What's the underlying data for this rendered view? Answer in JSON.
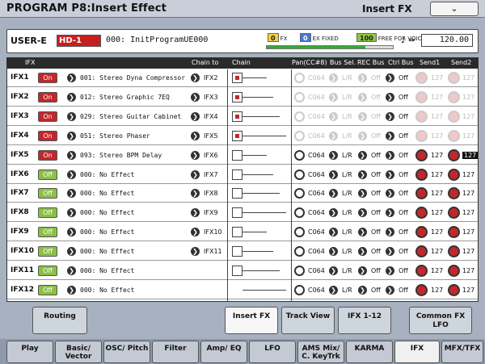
{
  "title": "PROGRAM P8:Insert Effect",
  "page_name": "Insert FX",
  "page_menu": "❯",
  "program": {
    "bank": "USER-E",
    "id": "HD-1",
    "name": "000: InitProgramUE000"
  },
  "status": {
    "fx_count": "0",
    "fx_label": "FX",
    "fixed_count": "0",
    "fixed_label": "EX FIXED",
    "free_count": "100",
    "free_label": "FREE FOR VOICES",
    "meter_fraction": 0.78
  },
  "tempo": {
    "symbol": "♩ =",
    "value": "120.00"
  },
  "columns": [
    "IFX",
    "Chain to",
    "Chain",
    "Pan(CC#8)",
    "Bus Sel.",
    "REC Bus",
    "Ctrl Bus",
    "Send1",
    "Send2"
  ],
  "rows": [
    {
      "num": "IFX1",
      "state": "On",
      "fx": "001: Stereo Dyna Compressor",
      "chain_to": "IFX2",
      "active": true,
      "pan": "C064",
      "bus": "L/R",
      "rec": "Off",
      "ctrl": "Off",
      "send1": "127",
      "send2": "127",
      "dim": true
    },
    {
      "num": "IFX2",
      "state": "On",
      "fx": "012: Stereo Graphic 7EQ",
      "chain_to": "IFX3",
      "active": true,
      "pan": "C064",
      "bus": "L/R",
      "rec": "Off",
      "ctrl": "Off",
      "send1": "127",
      "send2": "127",
      "dim": true
    },
    {
      "num": "IFX3",
      "state": "On",
      "fx": "029: Stereo Guitar Cabinet",
      "chain_to": "IFX4",
      "active": true,
      "pan": "C064",
      "bus": "L/R",
      "rec": "Off",
      "ctrl": "Off",
      "send1": "127",
      "send2": "127",
      "dim": true
    },
    {
      "num": "IFX4",
      "state": "On",
      "fx": "051: Stereo Phaser",
      "chain_to": "IFX5",
      "active": true,
      "pan": "C064",
      "bus": "L/R",
      "rec": "Off",
      "ctrl": "Off",
      "send1": "127",
      "send2": "127",
      "dim": true
    },
    {
      "num": "IFX5",
      "state": "On",
      "fx": "093: Stereo BPM Delay",
      "chain_to": "IFX6",
      "active": false,
      "pan": "C064",
      "bus": "L/R",
      "rec": "Off",
      "ctrl": "Off",
      "send1": "127",
      "send2": "127",
      "dim": false,
      "send2_hl": true
    },
    {
      "num": "IFX6",
      "state": "Off",
      "fx": "000: No Effect",
      "chain_to": "IFX7",
      "active": false,
      "pan": "C064",
      "bus": "L/R",
      "rec": "Off",
      "ctrl": "Off",
      "send1": "127",
      "send2": "127",
      "dim": false
    },
    {
      "num": "IFX7",
      "state": "Off",
      "fx": "000: No Effect",
      "chain_to": "IFX8",
      "active": false,
      "pan": "C064",
      "bus": "L/R",
      "rec": "Off",
      "ctrl": "Off",
      "send1": "127",
      "send2": "127",
      "dim": false
    },
    {
      "num": "IFX8",
      "state": "Off",
      "fx": "000: No Effect",
      "chain_to": "IFX9",
      "active": false,
      "pan": "C064",
      "bus": "L/R",
      "rec": "Off",
      "ctrl": "Off",
      "send1": "127",
      "send2": "127",
      "dim": false
    },
    {
      "num": "IFX9",
      "state": "Off",
      "fx": "000: No Effect",
      "chain_to": "IFX10",
      "active": false,
      "pan": "C064",
      "bus": "L/R",
      "rec": "Off",
      "ctrl": "Off",
      "send1": "127",
      "send2": "127",
      "dim": false
    },
    {
      "num": "IFX10",
      "state": "Off",
      "fx": "000: No Effect",
      "chain_to": "IFX11",
      "active": false,
      "pan": "C064",
      "bus": "L/R",
      "rec": "Off",
      "ctrl": "Off",
      "send1": "127",
      "send2": "127",
      "dim": false
    },
    {
      "num": "IFX11",
      "state": "Off",
      "fx": "000: No Effect",
      "chain_to": "",
      "active": false,
      "pan": "C064",
      "bus": "L/R",
      "rec": "Off",
      "ctrl": "Off",
      "send1": "127",
      "send2": "127",
      "dim": false
    },
    {
      "num": "IFX12",
      "state": "Off",
      "fx": "000: No Effect",
      "chain_to": "",
      "active": false,
      "pan": "C064",
      "bus": "L/R",
      "rec": "Off",
      "ctrl": "Off",
      "send1": "127",
      "send2": "127",
      "dim": false
    }
  ],
  "tabs_top": [
    {
      "label": "Routing",
      "selected": false
    },
    {
      "label": "Insert FX",
      "selected": true
    },
    {
      "label": "Track View",
      "selected": false
    },
    {
      "label": "IFX 1-12",
      "selected": false
    },
    {
      "label": "Common FX LFO",
      "selected": false
    }
  ],
  "tabs_bottom": [
    {
      "label": "Play",
      "selected": false
    },
    {
      "label": "Basic/ Vector",
      "selected": false
    },
    {
      "label": "OSC/ Pitch",
      "selected": false
    },
    {
      "label": "Filter",
      "selected": false
    },
    {
      "label": "Amp/ EQ",
      "selected": false
    },
    {
      "label": "LFO",
      "selected": false
    },
    {
      "label": "AMS Mix/ C. KeyTrk",
      "selected": false
    },
    {
      "label": "KARMA",
      "selected": false
    },
    {
      "label": "IFX",
      "selected": true
    },
    {
      "label": "MFX/TFX",
      "selected": false
    }
  ]
}
